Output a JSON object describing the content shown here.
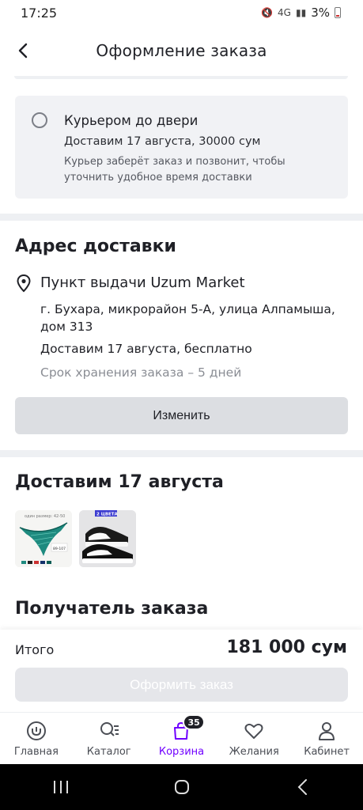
{
  "status_bar": {
    "time": "17:25",
    "network": "4G",
    "battery": "3%"
  },
  "header": {
    "title": "Оформление заказа"
  },
  "courier_option": {
    "title": "Курьером до двери",
    "subtitle": "Доставим 17 августа, 30000 сум",
    "description": "Курьер заберёт заказ и позвонит, чтобы уточнить удобное время доставки"
  },
  "address": {
    "section_title": "Адрес доставки",
    "pickup_title": "Пункт выдачи Uzum Market",
    "address_text": "г. Бухара, микрорайон 5-А, улица Алпамыша, дом 313",
    "delivery_info": "Доставим 17 августа, бесплатно",
    "storage_info": "Срок хранения заказа – 5 дней",
    "change_button": "Изменить"
  },
  "delivery": {
    "section_title": "Доставим 17 августа"
  },
  "thumbs": {
    "first": {
      "size_text": "один размер: 42-50",
      "code_text": "89-107"
    },
    "second": {
      "tag": "2 ЦВЕТА"
    }
  },
  "recipient": {
    "section_title": "Получатель заказа"
  },
  "total": {
    "label": "Итого",
    "value": "181 000 сум",
    "checkout_button": "Оформить заказ"
  },
  "tab_bar": {
    "items": [
      {
        "label": "Главная",
        "icon": "home-icon"
      },
      {
        "label": "Каталог",
        "icon": "catalog-search-icon"
      },
      {
        "label": "Корзина",
        "icon": "cart-bag-icon",
        "badge": "35",
        "active": true
      },
      {
        "label": "Желания",
        "icon": "heart-icon"
      },
      {
        "label": "Кабинет",
        "icon": "user-icon"
      }
    ]
  },
  "colors": {
    "accent": "#7000ff",
    "text": "#1f2026",
    "card_bg": "#f1f2f5"
  }
}
